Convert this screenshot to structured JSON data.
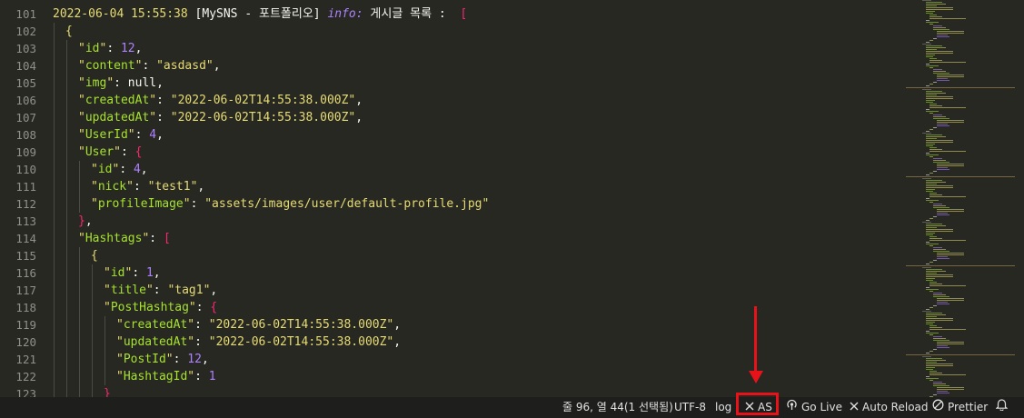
{
  "editor": {
    "lines": [
      {
        "num": "101",
        "indent": 0,
        "tokens": [
          [
            "ts",
            "2022-06-04 15:55:38 "
          ],
          [
            "br",
            "[MySNS - 포트폴리오] "
          ],
          [
            "kw",
            "info:"
          ],
          [
            "txt",
            " 게시글 목록 :  "
          ],
          [
            "bracket",
            "["
          ]
        ]
      },
      {
        "num": "102",
        "indent": 1,
        "tokens": [
          [
            "brace1",
            "{"
          ]
        ]
      },
      {
        "num": "103",
        "indent": 2,
        "tokens": [
          [
            "q",
            "\""
          ],
          [
            "key",
            "id"
          ],
          [
            "q",
            "\""
          ],
          [
            "punc",
            ": "
          ],
          [
            "num",
            "12"
          ],
          [
            "punc",
            ","
          ]
        ]
      },
      {
        "num": "104",
        "indent": 2,
        "tokens": [
          [
            "q",
            "\""
          ],
          [
            "key",
            "content"
          ],
          [
            "q",
            "\""
          ],
          [
            "punc",
            ": "
          ],
          [
            "str",
            "\"asdasd\""
          ],
          [
            "punc",
            ","
          ]
        ]
      },
      {
        "num": "105",
        "indent": 2,
        "tokens": [
          [
            "q",
            "\""
          ],
          [
            "key",
            "img"
          ],
          [
            "q",
            "\""
          ],
          [
            "punc",
            ": "
          ],
          [
            "null",
            "null"
          ],
          [
            "punc",
            ","
          ]
        ]
      },
      {
        "num": "106",
        "indent": 2,
        "tokens": [
          [
            "q",
            "\""
          ],
          [
            "key",
            "createdAt"
          ],
          [
            "q",
            "\""
          ],
          [
            "punc",
            ": "
          ],
          [
            "str",
            "\"2022-06-02T14:55:38.000Z\""
          ],
          [
            "punc",
            ","
          ]
        ]
      },
      {
        "num": "107",
        "indent": 2,
        "tokens": [
          [
            "q",
            "\""
          ],
          [
            "key",
            "updatedAt"
          ],
          [
            "q",
            "\""
          ],
          [
            "punc",
            ": "
          ],
          [
            "str",
            "\"2022-06-02T14:55:38.000Z\""
          ],
          [
            "punc",
            ","
          ]
        ]
      },
      {
        "num": "108",
        "indent": 2,
        "tokens": [
          [
            "q",
            "\""
          ],
          [
            "key",
            "UserId"
          ],
          [
            "q",
            "\""
          ],
          [
            "punc",
            ": "
          ],
          [
            "num",
            "4"
          ],
          [
            "punc",
            ","
          ]
        ]
      },
      {
        "num": "109",
        "indent": 2,
        "tokens": [
          [
            "q",
            "\""
          ],
          [
            "key",
            "User"
          ],
          [
            "q",
            "\""
          ],
          [
            "punc",
            ": "
          ],
          [
            "brace2",
            "{"
          ]
        ]
      },
      {
        "num": "110",
        "indent": 3,
        "tokens": [
          [
            "q",
            "\""
          ],
          [
            "key",
            "id"
          ],
          [
            "q",
            "\""
          ],
          [
            "punc",
            ": "
          ],
          [
            "num",
            "4"
          ],
          [
            "punc",
            ","
          ]
        ]
      },
      {
        "num": "111",
        "indent": 3,
        "tokens": [
          [
            "q",
            "\""
          ],
          [
            "key",
            "nick"
          ],
          [
            "q",
            "\""
          ],
          [
            "punc",
            ": "
          ],
          [
            "str",
            "\"test1\""
          ],
          [
            "punc",
            ","
          ]
        ]
      },
      {
        "num": "112",
        "indent": 3,
        "tokens": [
          [
            "q",
            "\""
          ],
          [
            "key",
            "profileImage"
          ],
          [
            "q",
            "\""
          ],
          [
            "punc",
            ": "
          ],
          [
            "str",
            "\"assets/images/user/default-profile.jpg\""
          ]
        ]
      },
      {
        "num": "113",
        "indent": 2,
        "tokens": [
          [
            "brace2",
            "}"
          ],
          [
            "punc",
            ","
          ]
        ]
      },
      {
        "num": "114",
        "indent": 2,
        "tokens": [
          [
            "q",
            "\""
          ],
          [
            "key",
            "Hashtags"
          ],
          [
            "q",
            "\""
          ],
          [
            "punc",
            ": "
          ],
          [
            "bracket",
            "["
          ]
        ]
      },
      {
        "num": "115",
        "indent": 3,
        "tokens": [
          [
            "brace1",
            "{"
          ]
        ]
      },
      {
        "num": "116",
        "indent": 4,
        "tokens": [
          [
            "q",
            "\""
          ],
          [
            "key",
            "id"
          ],
          [
            "q",
            "\""
          ],
          [
            "punc",
            ": "
          ],
          [
            "num",
            "1"
          ],
          [
            "punc",
            ","
          ]
        ]
      },
      {
        "num": "117",
        "indent": 4,
        "tokens": [
          [
            "q",
            "\""
          ],
          [
            "key",
            "title"
          ],
          [
            "q",
            "\""
          ],
          [
            "punc",
            ": "
          ],
          [
            "str",
            "\"tag1\""
          ],
          [
            "punc",
            ","
          ]
        ]
      },
      {
        "num": "118",
        "indent": 4,
        "tokens": [
          [
            "q",
            "\""
          ],
          [
            "key",
            "PostHashtag"
          ],
          [
            "q",
            "\""
          ],
          [
            "punc",
            ": "
          ],
          [
            "brace2",
            "{"
          ]
        ]
      },
      {
        "num": "119",
        "indent": 5,
        "tokens": [
          [
            "q",
            "\""
          ],
          [
            "key",
            "createdAt"
          ],
          [
            "q",
            "\""
          ],
          [
            "punc",
            ": "
          ],
          [
            "str",
            "\"2022-06-02T14:55:38.000Z\""
          ],
          [
            "punc",
            ","
          ]
        ]
      },
      {
        "num": "120",
        "indent": 5,
        "tokens": [
          [
            "q",
            "\""
          ],
          [
            "key",
            "updatedAt"
          ],
          [
            "q",
            "\""
          ],
          [
            "punc",
            ": "
          ],
          [
            "str",
            "\"2022-06-02T14:55:38.000Z\""
          ],
          [
            "punc",
            ","
          ]
        ]
      },
      {
        "num": "121",
        "indent": 5,
        "tokens": [
          [
            "q",
            "\""
          ],
          [
            "key",
            "PostId"
          ],
          [
            "q",
            "\""
          ],
          [
            "punc",
            ": "
          ],
          [
            "num",
            "12"
          ],
          [
            "punc",
            ","
          ]
        ]
      },
      {
        "num": "122",
        "indent": 5,
        "tokens": [
          [
            "q",
            "\""
          ],
          [
            "key",
            "HashtagId"
          ],
          [
            "q",
            "\""
          ],
          [
            "punc",
            ": "
          ],
          [
            "num",
            "1"
          ]
        ]
      },
      {
        "num": "123",
        "indent": 4,
        "tokens": [
          [
            "brace2",
            "}"
          ]
        ]
      }
    ]
  },
  "statusbar": {
    "cursor_position": "줄 96, 열 44(1 선택됨)",
    "encoding": "UTF-8",
    "language": "log",
    "as_label": "AS",
    "go_live_label": "Go Live",
    "auto_reload_label": "Auto Reload",
    "prettier_label": "Prettier"
  },
  "icons": {
    "as": "close-x-icon",
    "go_live": "broadcast-icon",
    "auto_reload": "close-x-icon",
    "prettier": "double-circle-slash-icon",
    "notifications": "bell-icon"
  },
  "colors": {
    "background": "#272822",
    "statusbar": "#1e1f1c",
    "highlight": "#e8131a"
  }
}
